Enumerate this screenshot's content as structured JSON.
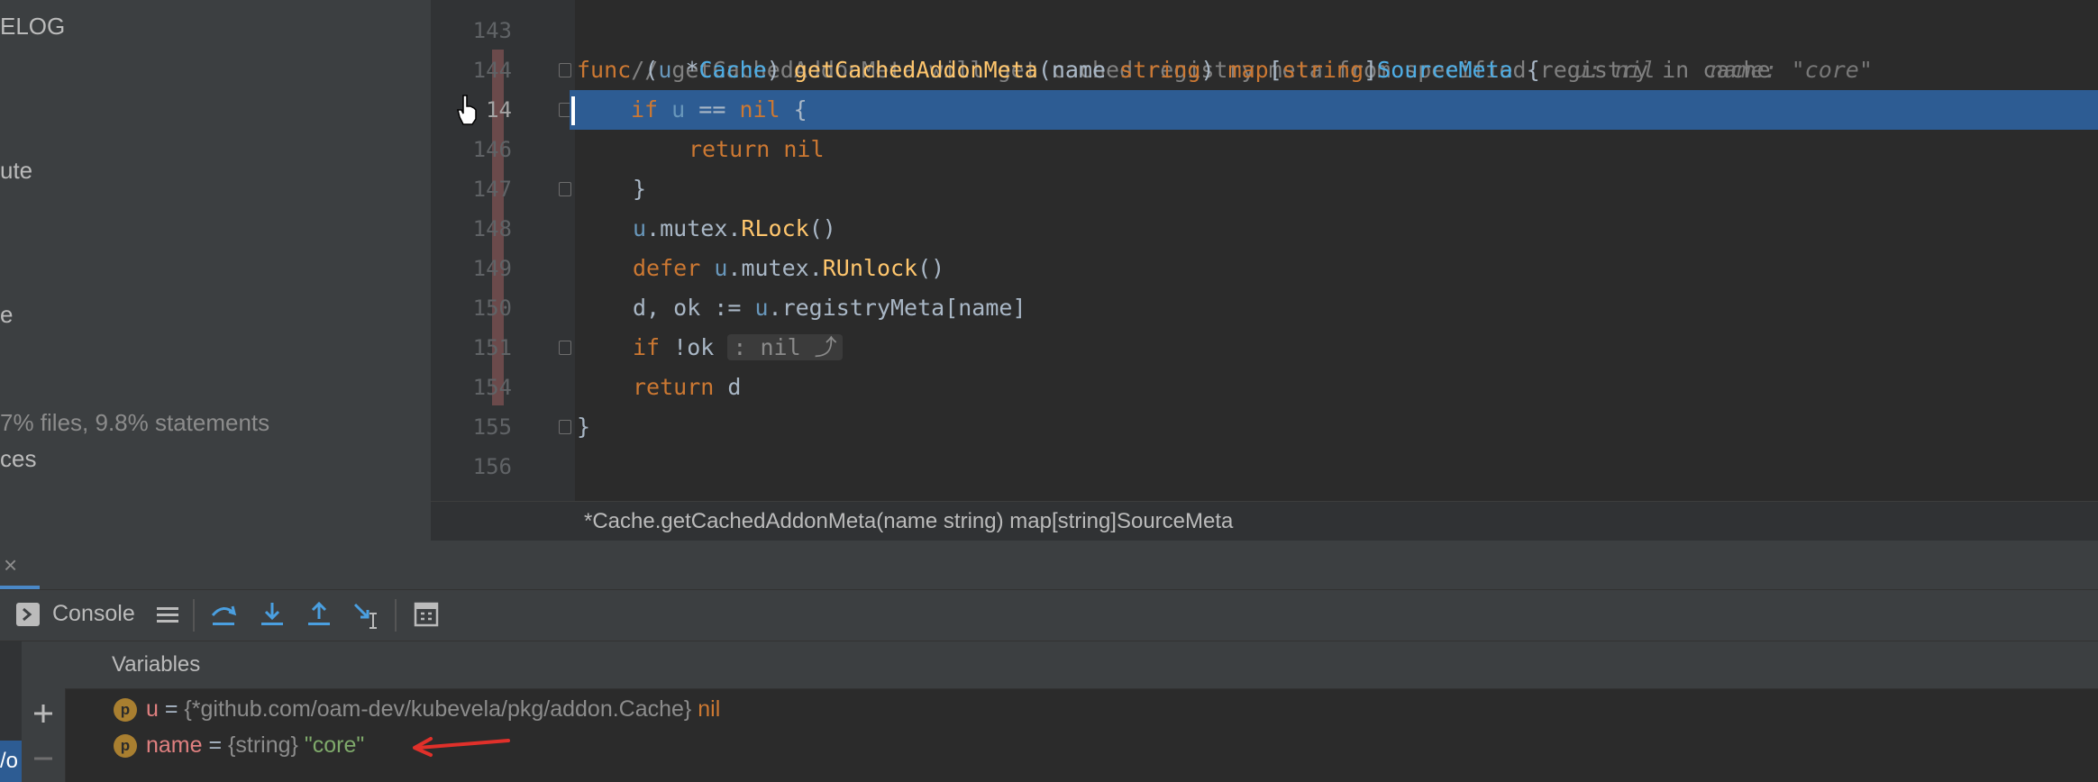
{
  "project_tree": {
    "items": [
      {
        "label": "ELOG",
        "muted": false
      },
      {
        "label": "ute",
        "muted": false
      },
      {
        "label": "e",
        "muted": false
      },
      {
        "label": "7% files, 9.8% statements",
        "muted": true
      },
      {
        "label": "ces",
        "muted": false
      }
    ]
  },
  "editor": {
    "line_numbers": [
      "143",
      "144",
      "14",
      "146",
      "147",
      "148",
      "149",
      "150",
      "151",
      "154",
      "155",
      "156"
    ],
    "lines": {
      "l143": {
        "comment": "// getCachedAddonMeta will get cached registry meta from specified registry in cache"
      },
      "l144": {
        "func": "func",
        "open": " (",
        "recv": "u",
        "star": " *",
        "type": "Cache",
        "close": ") ",
        "name": "getCachedAddonMeta",
        "params_open": "(",
        "param": "name ",
        "param_type": "string",
        "params_close": ") ",
        "ret_kw": "map",
        "ret_br_open": "[",
        "ret_key": "string",
        "ret_br_close": "]",
        "ret_type": "SourceMeta",
        "brace": " {",
        "inline_hint": "u: nil    name: \"core\""
      },
      "l145": {
        "if": "if",
        "rest_a": " ",
        "recv": "u",
        "rest_b": " == ",
        "nil": "nil",
        "brace": " {"
      },
      "l146": {
        "return": "return",
        "nil": " nil"
      },
      "l147": {
        "brace": "}"
      },
      "l148": {
        "recv": "u",
        "rest": ".mutex.",
        "method": "RLock",
        "parens": "()"
      },
      "l149": {
        "defer": "defer",
        "sp": " ",
        "recv": "u",
        "rest": ".mutex.",
        "method": "RUnlock",
        "parens": "()"
      },
      "l150": {
        "lhs": "d, ok := ",
        "recv": "u",
        "rest": ".registryMeta[name]"
      },
      "l151": {
        "if": "if",
        "cond": " !ok ",
        "folded": ": nil ⤴"
      },
      "l154": {
        "return": "return",
        "val": " d"
      },
      "l155": {
        "brace": "}"
      }
    },
    "breadcrumb": "*Cache.getCachedAddonMeta(name string) map[string]SourceMeta"
  },
  "debug": {
    "close_icon": "×",
    "console_label": "Console",
    "variables_header": "Variables",
    "variables": [
      {
        "name": "u",
        "eq": " = ",
        "type": "{*github.com/oam-dev/kubevela/pkg/addon.Cache}",
        "value": " nil",
        "value_kind": "nil"
      },
      {
        "name": "name",
        "eq": " = ",
        "type": "{string}",
        "value": " \"core\"",
        "value_kind": "string"
      }
    ],
    "badge_letter": "p",
    "left_edge_text": "/o"
  },
  "colors": {
    "highlight": "#2d5c93",
    "keyword": "#cc7832",
    "function": "#ffc66d",
    "annotation_arrow": "#e0302a"
  }
}
